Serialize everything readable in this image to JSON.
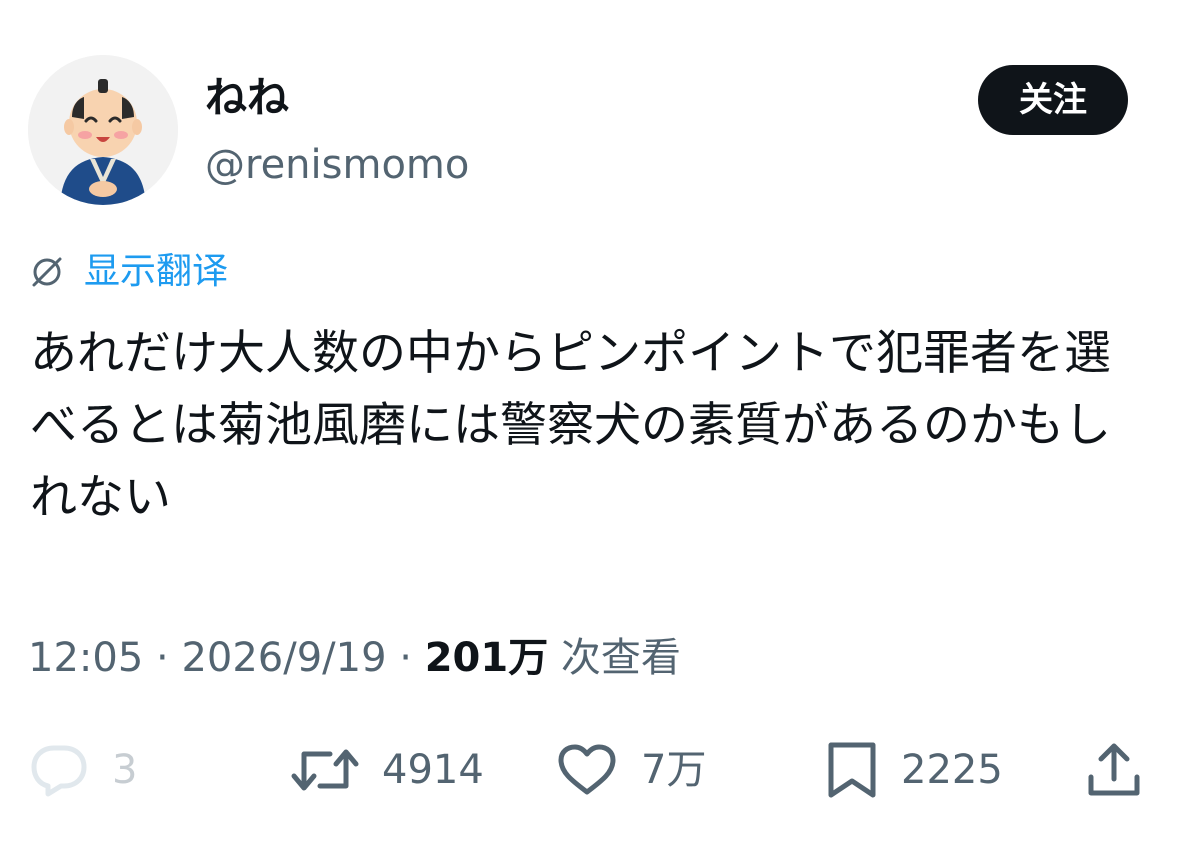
{
  "author": {
    "display_name": "ねね",
    "handle": "@renismomo",
    "avatar_icon": "samurai-avatar-illustration"
  },
  "follow_button": {
    "label": "关注"
  },
  "translate": {
    "icon": "globe-translate-icon",
    "label": "显示翻译"
  },
  "tweet": {
    "text": "あれだけ大人数の中からピンポイントで犯罪者を選べるとは菊池風磨には警察犬の素質があるのかもしれない"
  },
  "meta": {
    "time": "12:05",
    "separator": " · ",
    "date": "2026/9/19",
    "views_count": "201万",
    "views_label": " 次查看"
  },
  "actions": {
    "reply": {
      "icon": "reply-bubble-icon",
      "count": "3"
    },
    "retweet": {
      "icon": "retweet-icon",
      "count": "4914"
    },
    "like": {
      "icon": "heart-icon",
      "count": "7万"
    },
    "bookmark": {
      "icon": "bookmark-icon",
      "count": "2225"
    },
    "share": {
      "icon": "share-upload-icon"
    }
  },
  "colors": {
    "text_primary": "#0f1419",
    "text_secondary": "#536471",
    "accent": "#1d9bf0",
    "button_bg": "#0f1419"
  }
}
